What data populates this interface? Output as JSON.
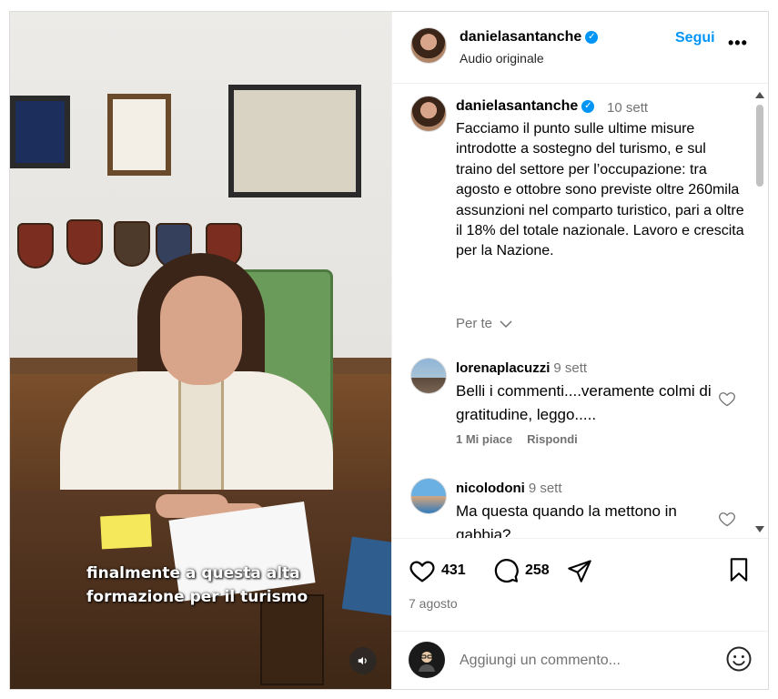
{
  "video": {
    "caption_lines": [
      "finalmente a questa alta",
      "formazione per il turismo"
    ],
    "mute_icon": "speaker-icon"
  },
  "header": {
    "username": "danielasantanche",
    "verified": true,
    "audio": "Audio originale",
    "follow_label": "Segui",
    "more_label": "•••"
  },
  "caption": {
    "username": "danielasantanche",
    "time": "10 sett",
    "text": "Facciamo il punto sulle ultime misure introdotte a sostegno del turismo, e sul traino del settore per l’occupazione: tra agosto e ottobre sono previste oltre 260mila assunzioni nel comparto turistico, pari a oltre il 18% del totale nazionale. Lavoro e crescita per la Nazione.",
    "for_you_label": "Per te"
  },
  "comments": [
    {
      "username": "lorenaplacuzzi",
      "time": "9 sett",
      "text": "Belli i commenti....veramente colmi di gratitudine, leggo.....",
      "likes_label": "1 Mi piace",
      "reply_label": "Rispondi"
    },
    {
      "username": "nicolodoni",
      "time": "9 sett",
      "text": "Ma questa quando la mettono in gabbia?"
    }
  ],
  "actions": {
    "likes": "431",
    "comments": "258",
    "date": "7 agosto"
  },
  "composer": {
    "placeholder": "Aggiungi un commento..."
  },
  "colors": {
    "accent": "#0095f6",
    "muted": "#737373",
    "border": "#dbdbdb"
  }
}
